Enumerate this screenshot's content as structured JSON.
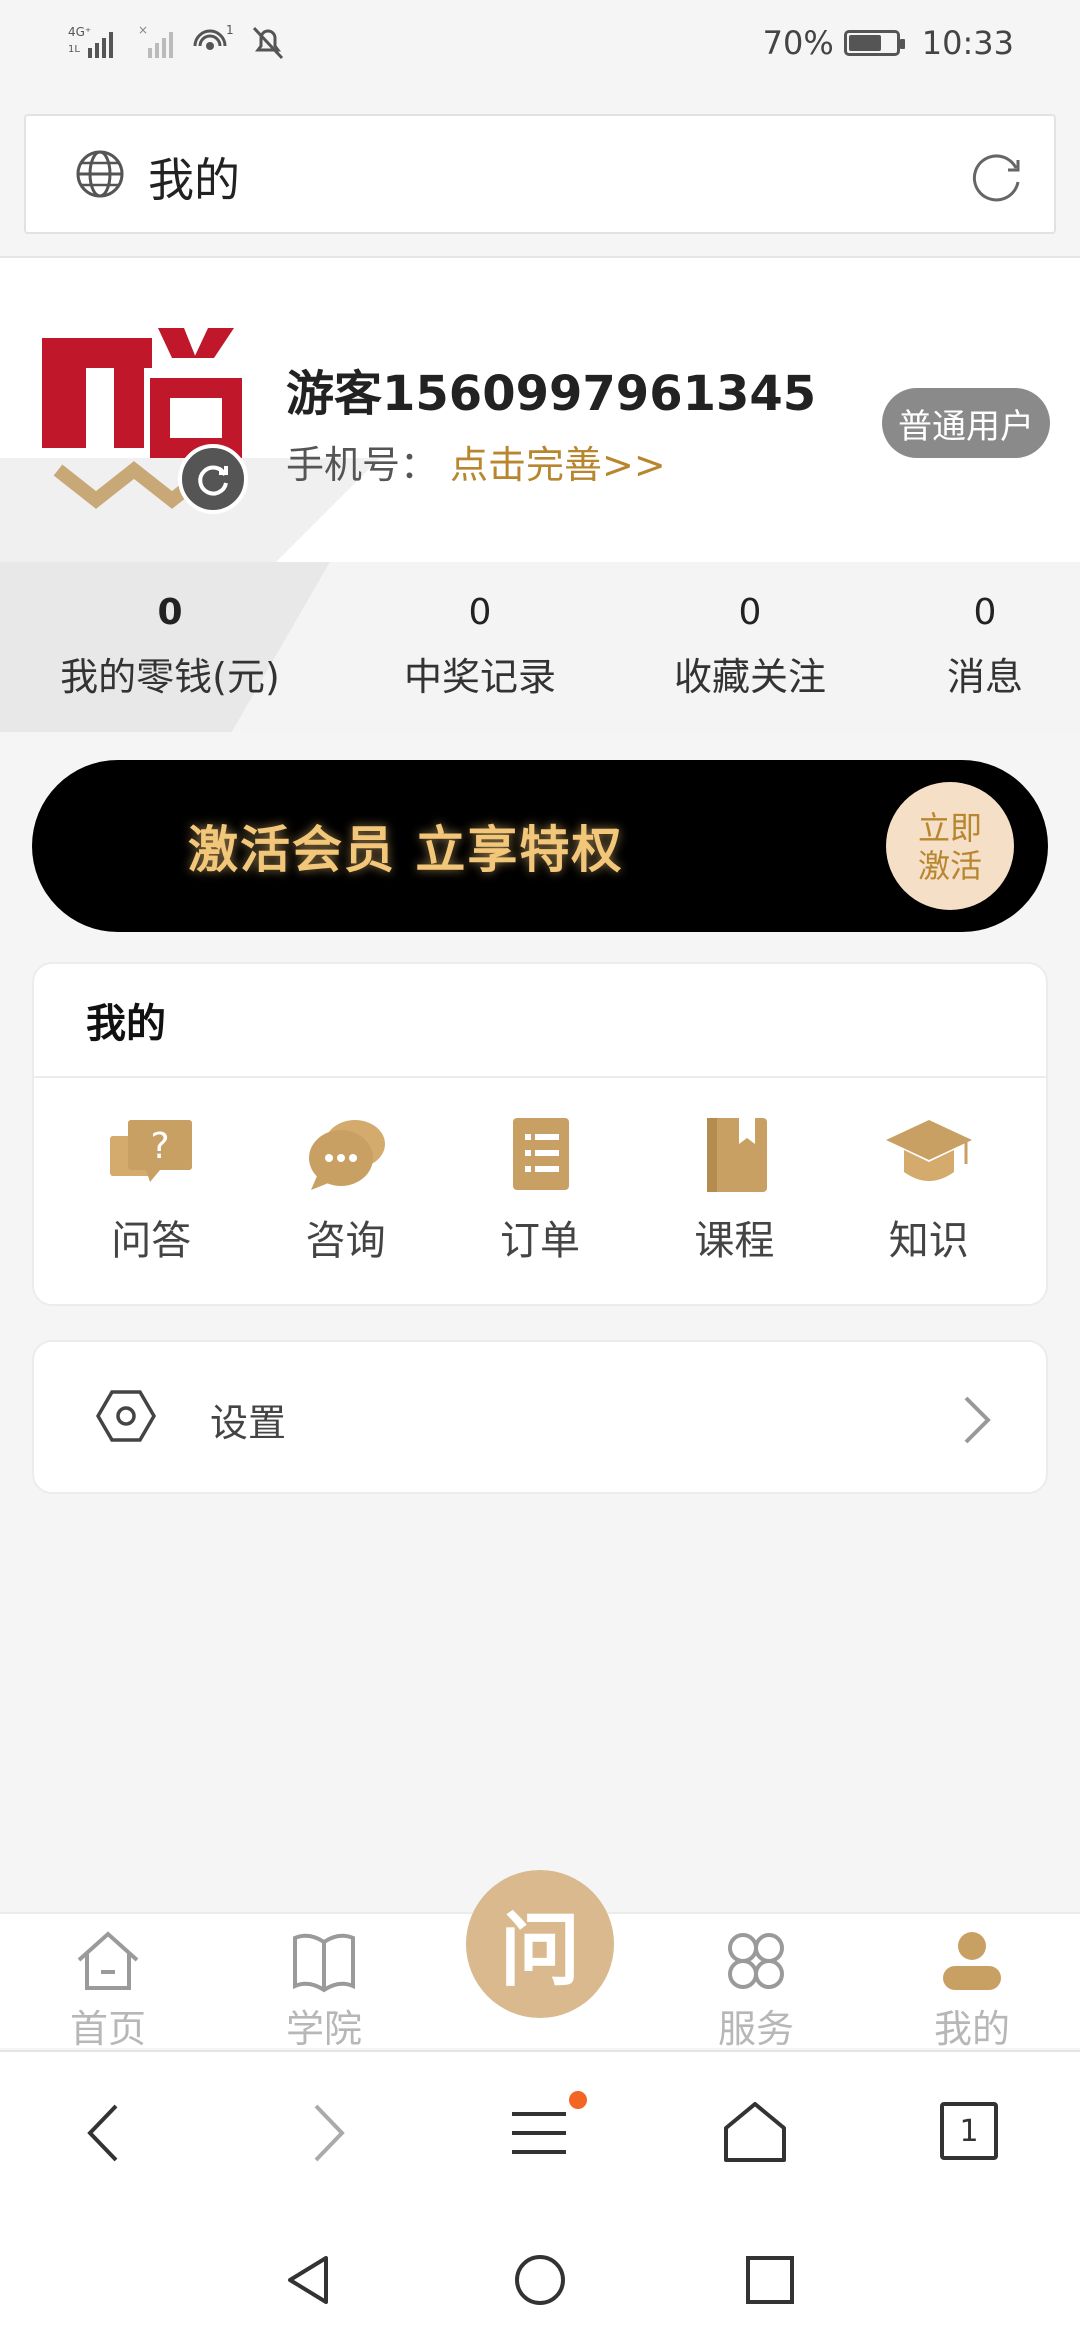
{
  "status_bar": {
    "network": "4G",
    "battery_text": "70%",
    "battery_level": 0.7,
    "time": "10:33"
  },
  "browser": {
    "title": "我的",
    "globe_icon": "globe-icon",
    "reload_icon": "reload-icon"
  },
  "profile": {
    "username": "游客1560997961345",
    "phone_label": "手机号：",
    "phone_link": "点击完善>>",
    "badge": "普通用户",
    "logo_color": "#c0172b",
    "logo_accent": "#c9a878"
  },
  "stats": [
    {
      "value": "0",
      "label": "我的零钱(元)"
    },
    {
      "value": "0",
      "label": "中奖记录"
    },
    {
      "value": "0",
      "label": "收藏关注"
    },
    {
      "value": "0",
      "label": "消息"
    }
  ],
  "banner": {
    "text": "激活会员 立享特权",
    "button_line1": "立即",
    "button_line2": "激活"
  },
  "my_card": {
    "title": "我的",
    "items": [
      {
        "label": "问答",
        "icon": "qa-icon"
      },
      {
        "label": "咨询",
        "icon": "consult-icon"
      },
      {
        "label": "订单",
        "icon": "order-icon"
      },
      {
        "label": "课程",
        "icon": "course-icon"
      },
      {
        "label": "知识",
        "icon": "knowledge-icon"
      }
    ]
  },
  "settings": {
    "label": "设置"
  },
  "tabbar": {
    "items": [
      {
        "label": "首页",
        "icon": "home-icon"
      },
      {
        "label": "学院",
        "icon": "book-icon"
      },
      {
        "label": "服务",
        "icon": "services-icon"
      },
      {
        "label": "我的",
        "icon": "user-icon"
      }
    ],
    "center_label": "问",
    "accent": "#d9b98d"
  },
  "browser_nav": {
    "tab_count": "1"
  },
  "colors": {
    "gold": "#c9a063",
    "link": "#b8862e",
    "banner_text": "#f3c77a"
  }
}
